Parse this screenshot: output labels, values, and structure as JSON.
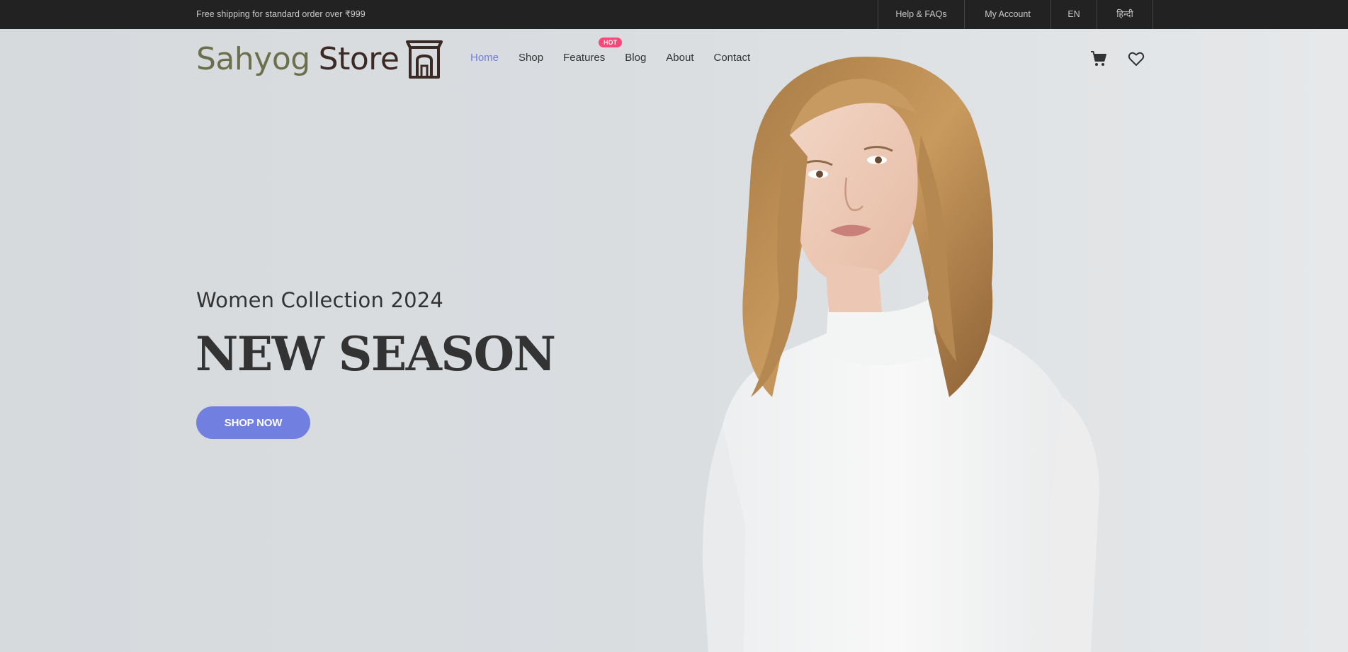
{
  "topbar": {
    "shipping_text": "Free shipping for standard order over ₹999",
    "links": {
      "help": "Help & FAQs",
      "account": "My Account",
      "en": "EN",
      "hindi": "हिन्दी"
    }
  },
  "header": {
    "logo": {
      "word1": "Sahyog",
      "word2": "Store",
      "icon": "storefront-icon"
    },
    "nav": {
      "home": "Home",
      "shop": "Shop",
      "features": "Features",
      "features_badge": "HOT",
      "blog": "Blog",
      "about": "About",
      "contact": "Contact"
    },
    "icons": [
      "cart-icon",
      "heart-icon"
    ]
  },
  "hero": {
    "subtitle": "Women Collection 2024",
    "title": "NEW SEASON",
    "button": "SHOP NOW"
  },
  "colors": {
    "accent": "#717fe0",
    "badge": "#f74877",
    "topbar_bg": "#222222",
    "hero_bg": "#d9dde0",
    "logo_word1": "#6c6f4c",
    "logo_word2": "#3b2a24"
  }
}
